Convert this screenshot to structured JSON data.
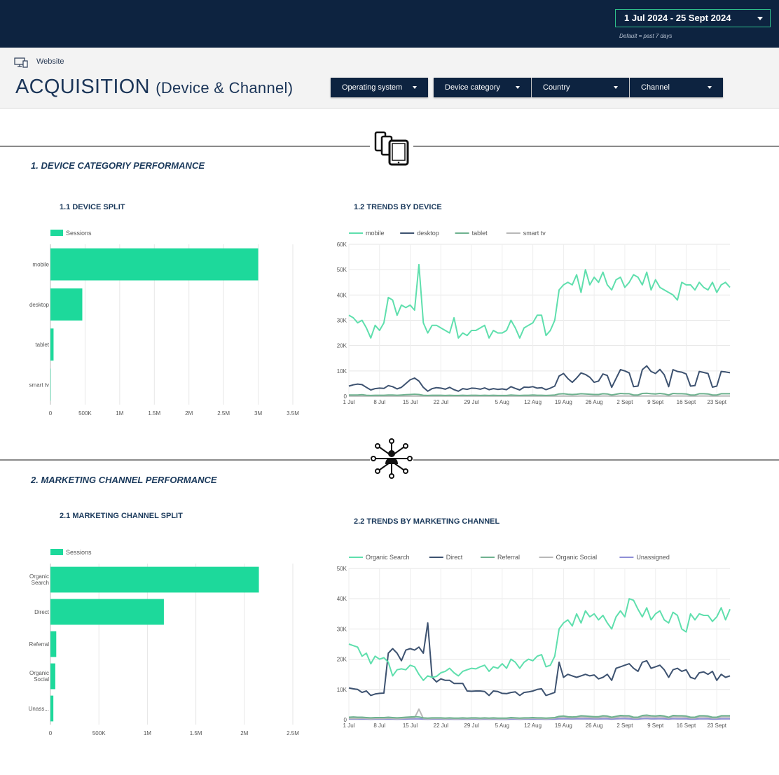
{
  "header": {
    "date_range": "1 Jul 2024 - 25 Sept 2024",
    "date_note": "Default = past 7 days",
    "website_label": "Website",
    "title": "ACQUISITION",
    "subtitle": "(Device & Channel)",
    "filters": [
      "Operating system",
      "Device category",
      "Country",
      "Channel"
    ]
  },
  "sections": {
    "device": {
      "title": "1. DEVICE CATEGORIY PERFORMANCE",
      "icon": "devices-icon"
    },
    "channel": {
      "title": "2. MARKETING CHANNEL PERFORMANCE",
      "icon": "network-person-icon"
    }
  },
  "colors": {
    "accent": "#1dd99b",
    "navy": "#0d2340",
    "mobile": "#5fdfad",
    "desktop": "#3d5270",
    "tablet": "#6eb28f",
    "smart_tv": "#b8b8b8",
    "organic_search": "#5fdfad",
    "direct": "#3d5270",
    "referral": "#6eb28f",
    "organic_social": "#b8b8b8",
    "unassigned": "#8e8ed6"
  },
  "chart_data": [
    {
      "id": "device_split",
      "title": "1.1 DEVICE SPLIT",
      "type": "bar",
      "orientation": "horizontal",
      "legend": [
        "Sessions"
      ],
      "categories": [
        "mobile",
        "desktop",
        "tablet",
        "smart tv"
      ],
      "values": [
        3000000,
        460000,
        45000,
        5000
      ],
      "xlim": [
        0,
        3500000
      ],
      "xticks": [
        "0",
        "500K",
        "1M",
        "1.5M",
        "2M",
        "2.5M",
        "3M",
        "3.5M"
      ],
      "grid": true
    },
    {
      "id": "device_trend",
      "title": "1.2 TRENDS  BY DEVICE",
      "type": "line",
      "xticks": [
        "1 Jul",
        "8 Jul",
        "15 Jul",
        "22 Jul",
        "29 Jul",
        "5 Aug",
        "12 Aug",
        "19 Aug",
        "26 Aug",
        "2 Sept",
        "9 Sept",
        "16 Sept",
        "23 Sept"
      ],
      "yticks": [
        "0",
        "10K",
        "20K",
        "30K",
        "40K",
        "50K",
        "60K"
      ],
      "ylim": [
        0,
        60000
      ],
      "legend_position": "top",
      "series": [
        {
          "name": "mobile",
          "values": [
            32000,
            31000,
            29000,
            30000,
            27000,
            23000,
            28000,
            26000,
            29000,
            39000,
            38000,
            32000,
            36000,
            35000,
            36000,
            34000,
            52000,
            29000,
            25000,
            28000,
            28000,
            27000,
            26000,
            25000,
            31000,
            23000,
            25000,
            24000,
            26000,
            26000,
            27000,
            28000,
            23000,
            26000,
            25000,
            25000,
            26000,
            30000,
            27000,
            23000,
            27000,
            28000,
            29000,
            32000,
            32000,
            24000,
            26000,
            30000,
            42000,
            44000,
            45000,
            44000,
            48000,
            41000,
            50000,
            44000,
            47000,
            45000,
            49000,
            44000,
            42000,
            46000,
            47000,
            43000,
            45000,
            48000,
            47000,
            44000,
            49000,
            42000,
            46000,
            43000,
            42000,
            41000,
            40000,
            38000,
            45000,
            44000,
            44000,
            42000,
            45000,
            43000,
            42000,
            45000,
            41000,
            44000,
            45000,
            43000
          ]
        },
        {
          "name": "desktop",
          "values": [
            4000,
            4500,
            4800,
            4600,
            3500,
            2500,
            3000,
            3200,
            3100,
            4200,
            3800,
            2900,
            3500,
            5000,
            6500,
            7200,
            6000,
            3500,
            2000,
            3000,
            3400,
            3200,
            2800,
            3500,
            2600,
            2000,
            3000,
            2700,
            3200,
            3100,
            2800,
            3300,
            2600,
            3000,
            2700,
            2900,
            2600,
            3800,
            3100,
            2500,
            3600,
            3500,
            3800,
            3200,
            3400,
            2600,
            3200,
            4000,
            8000,
            9000,
            7000,
            5500,
            7200,
            9200,
            8600,
            7500,
            5500,
            6000,
            8800,
            8200,
            3500,
            7000,
            10500,
            10000,
            9200,
            3800,
            4000,
            10500,
            12000,
            9800,
            9000,
            10600,
            8500,
            3800,
            10500,
            9800,
            9500,
            8800,
            4000,
            4200,
            9800,
            9400,
            9000,
            3600,
            4000,
            9800,
            9600,
            9300
          ]
        },
        {
          "name": "tablet",
          "values": [
            500,
            500,
            500,
            600,
            400,
            300,
            400,
            400,
            400,
            500,
            500,
            400,
            500,
            600,
            700,
            800,
            700,
            400,
            300,
            400,
            400,
            400,
            300,
            400,
            300,
            300,
            400,
            300,
            400,
            400,
            300,
            400,
            300,
            400,
            300,
            300,
            300,
            500,
            400,
            300,
            400,
            400,
            500,
            400,
            400,
            300,
            400,
            500,
            900,
            1000,
            800,
            700,
            800,
            1000,
            900,
            800,
            700,
            700,
            1000,
            900,
            500,
            800,
            1100,
            1000,
            1000,
            500,
            500,
            1100,
            1200,
            1000,
            900,
            1100,
            900,
            500,
            1100,
            1000,
            1000,
            900,
            500,
            500,
            1000,
            1000,
            900,
            500,
            500,
            1000,
            1000,
            1000
          ]
        },
        {
          "name": "smart tv",
          "values": [
            60,
            60,
            60,
            70,
            60,
            50,
            60,
            60,
            60,
            60,
            60,
            50,
            60,
            70,
            80,
            80,
            80,
            60,
            50,
            60,
            60,
            60,
            50,
            60,
            50,
            50,
            60,
            50,
            60,
            60,
            50,
            60,
            50,
            60,
            50,
            50,
            50,
            60,
            60,
            50,
            60,
            60,
            60,
            60,
            60,
            50,
            60,
            60,
            90,
            100,
            90,
            80,
            90,
            100,
            100,
            90,
            80,
            80,
            100,
            100,
            60,
            90,
            110,
            110,
            100,
            60,
            60,
            110,
            120,
            100,
            100,
            110,
            100,
            60,
            110,
            100,
            100,
            100,
            60,
            60,
            100,
            100,
            100,
            60,
            60,
            100,
            100,
            100
          ]
        }
      ]
    },
    {
      "id": "channel_split",
      "title": "2.1 MARKETING CHANNEL SPLIT",
      "type": "bar",
      "orientation": "horizontal",
      "legend": [
        "Sessions"
      ],
      "categories": [
        "Organic Search",
        "Direct",
        "Referral",
        "Organic Social",
        "Unass..."
      ],
      "values": [
        2150000,
        1170000,
        60000,
        50000,
        30000
      ],
      "xlim": [
        0,
        2500000
      ],
      "xticks": [
        "0",
        "500K",
        "1M",
        "1.5M",
        "2M",
        "2.5M"
      ],
      "grid": true
    },
    {
      "id": "channel_trend",
      "title": "2.2 TRENDS  BY MARKETING CHANNEL",
      "type": "line",
      "xticks": [
        "1 Jul",
        "8 Jul",
        "15 Jul",
        "22 Jul",
        "29 Jul",
        "5 Aug",
        "12 Aug",
        "19 Aug",
        "26 Aug",
        "2 Sept",
        "9 Sept",
        "16 Sept",
        "23 Sept"
      ],
      "yticks": [
        "0",
        "10K",
        "20K",
        "30K",
        "40K",
        "50K"
      ],
      "ylim": [
        0,
        50000
      ],
      "legend_position": "top",
      "series": [
        {
          "name": "Organic Search",
          "values": [
            25000,
            24500,
            24000,
            21000,
            22000,
            18500,
            21000,
            20000,
            20500,
            19000,
            14500,
            16500,
            16800,
            16500,
            18000,
            17500,
            15000,
            13000,
            14500,
            14000,
            14300,
            15500,
            16000,
            17000,
            15500,
            14500,
            16000,
            16500,
            17000,
            16800,
            17500,
            18000,
            16000,
            17500,
            17000,
            18500,
            17000,
            20000,
            19000,
            17000,
            19000,
            20000,
            19500,
            21000,
            21500,
            17500,
            18000,
            21000,
            30000,
            32000,
            33000,
            31000,
            35000,
            32000,
            36000,
            34000,
            35000,
            33000,
            34500,
            32000,
            30000,
            34000,
            36000,
            34000,
            40000,
            39500,
            36500,
            34000,
            37000,
            33000,
            35000,
            36000,
            33000,
            32000,
            35500,
            34500,
            30000,
            29000,
            35000,
            33000,
            35000,
            34500,
            34500,
            32500,
            34000,
            37000,
            33000,
            36500
          ]
        },
        {
          "name": "Direct",
          "values": [
            10500,
            10200,
            10000,
            9000,
            9500,
            8000,
            8500,
            8700,
            8800,
            22000,
            23500,
            22000,
            19500,
            23000,
            23500,
            23000,
            24000,
            22000,
            32000,
            14000,
            12500,
            13500,
            13000,
            13000,
            12000,
            12000,
            12000,
            9500,
            9400,
            9500,
            9500,
            9300,
            8000,
            9500,
            9300,
            8700,
            8600,
            9000,
            9200,
            8000,
            9000,
            9200,
            9500,
            10000,
            10200,
            8000,
            8500,
            9000,
            19000,
            14000,
            15000,
            14500,
            14000,
            14500,
            15000,
            14500,
            14800,
            13500,
            14000,
            15000,
            13000,
            17000,
            17500,
            18000,
            18500,
            17000,
            16000,
            19000,
            19500,
            17000,
            17500,
            18000,
            16500,
            14000,
            16500,
            17000,
            16000,
            16500,
            14000,
            13500,
            15500,
            15800,
            15000,
            16000,
            13000,
            15000,
            14000,
            14500
          ]
        },
        {
          "name": "Referral",
          "values": [
            800,
            900,
            800,
            800,
            700,
            600,
            700,
            700,
            700,
            800,
            700,
            600,
            700,
            800,
            900,
            1000,
            900,
            600,
            500,
            600,
            600,
            600,
            500,
            600,
            500,
            500,
            600,
            500,
            600,
            600,
            500,
            600,
            500,
            600,
            500,
            500,
            500,
            700,
            600,
            500,
            600,
            600,
            700,
            600,
            600,
            500,
            600,
            700,
            1100,
            1200,
            1000,
            900,
            1000,
            1300,
            1200,
            1100,
            1000,
            1000,
            1300,
            1200,
            800,
            1100,
            1400,
            1300,
            1300,
            800,
            800,
            1400,
            1500,
            1300,
            1200,
            1400,
            1200,
            800,
            1400,
            1300,
            1300,
            1200,
            800,
            800,
            1300,
            1300,
            1200,
            800,
            800,
            1300,
            1300,
            1300
          ]
        },
        {
          "name": "Organic Social",
          "values": [
            400,
            400,
            400,
            500,
            400,
            300,
            400,
            400,
            400,
            500,
            400,
            300,
            400,
            500,
            600,
            600,
            3500,
            400,
            300,
            400,
            400,
            400,
            300,
            400,
            300,
            300,
            400,
            300,
            400,
            400,
            300,
            400,
            300,
            400,
            300,
            300,
            300,
            500,
            400,
            300,
            400,
            400,
            500,
            400,
            400,
            300,
            400,
            500,
            800,
            900,
            700,
            600,
            700,
            900,
            800,
            700,
            600,
            600,
            900,
            800,
            500,
            700,
            1000,
            900,
            900,
            500,
            500,
            1000,
            1000,
            900,
            800,
            1000,
            800,
            500,
            1000,
            900,
            900,
            800,
            500,
            500,
            900,
            900,
            800,
            500,
            500,
            900,
            900,
            900
          ]
        },
        {
          "name": "Unassigned",
          "values": [
            200,
            200,
            200,
            200,
            200,
            150,
            200,
            200,
            200,
            200,
            200,
            150,
            200,
            200,
            250,
            250,
            250,
            200,
            150,
            200,
            200,
            200,
            150,
            200,
            150,
            150,
            200,
            150,
            200,
            200,
            150,
            200,
            150,
            200,
            150,
            150,
            150,
            200,
            200,
            150,
            200,
            200,
            200,
            200,
            200,
            150,
            200,
            200,
            300,
            300,
            300,
            250,
            300,
            300,
            300,
            300,
            250,
            250,
            300,
            300,
            200,
            300,
            350,
            350,
            300,
            200,
            200,
            350,
            400,
            300,
            300,
            350,
            300,
            200,
            350,
            300,
            300,
            300,
            200,
            200,
            300,
            300,
            300,
            200,
            200,
            300,
            300,
            300
          ]
        }
      ]
    }
  ]
}
